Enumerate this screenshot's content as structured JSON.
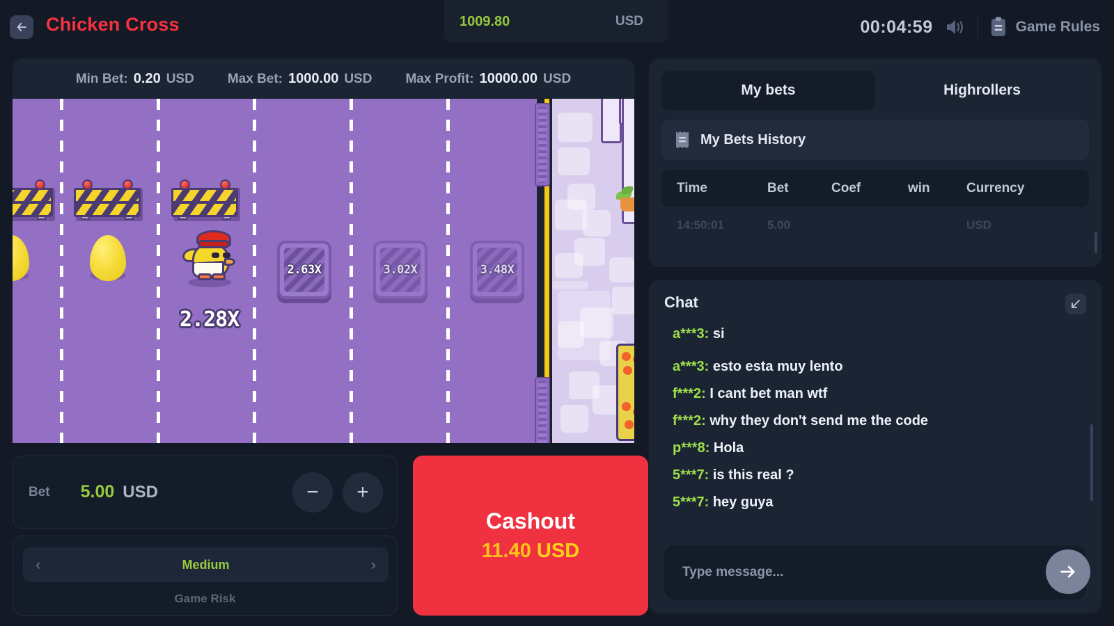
{
  "header": {
    "back_icon": "arrow-left-icon",
    "title": "Chicken Cross",
    "balance_value": "1009.80",
    "balance_currency": "USD",
    "timer": "00:04:59",
    "sound_icon": "speaker-on-icon",
    "rules_icon": "clipboard-icon",
    "rules_label": "Game Rules"
  },
  "limits": [
    {
      "label": "Min Bet:",
      "value": "0.20",
      "currency": "USD"
    },
    {
      "label": "Max Bet:",
      "value": "1000.00",
      "currency": "USD"
    },
    {
      "label": "Max Profit:",
      "value": "10000.00",
      "currency": "USD"
    }
  ],
  "game": {
    "current_multiplier": "2.28X",
    "upcoming_multipliers": [
      "2.63X",
      "3.02X",
      "3.48X"
    ],
    "road_color": "#9370c4",
    "sidewalk_color": "#d9cdee",
    "curb_color": "#f5c518"
  },
  "bet": {
    "label": "Bet",
    "value": "5.00",
    "currency": "USD",
    "decrease_label": "−",
    "increase_label": "+"
  },
  "risk": {
    "value": "Medium",
    "caption": "Game Risk",
    "prev_icon": "chevron-left-icon",
    "next_icon": "chevron-right-icon"
  },
  "cashout": {
    "title": "Cashout",
    "amount": "11.40",
    "currency": "USD",
    "color": "#f0313f"
  },
  "bets_panel": {
    "tabs": [
      {
        "label": "My bets",
        "active": true
      },
      {
        "label": "Highrollers",
        "active": false
      }
    ],
    "history_icon": "receipt-icon",
    "history_label": "My Bets History",
    "columns": [
      "Time",
      "Bet",
      "Coef",
      "win",
      "Currency"
    ],
    "rows": [
      {
        "time": "14:50:01",
        "bet": "5.00",
        "coef": "",
        "win": "",
        "currency": "USD"
      }
    ]
  },
  "chat": {
    "title": "Chat",
    "expand_icon": "collapse-arrow-icon",
    "messages": [
      {
        "user": "a***3:",
        "text": "si"
      },
      {
        "user": "a***3:",
        "text": "esto esta muy lento"
      },
      {
        "user": "f***2:",
        "text": "I cant bet man wtf"
      },
      {
        "user": "f***2:",
        "text": "why they don't send me the code"
      },
      {
        "user": "p***8:",
        "text": "Hola"
      },
      {
        "user": "5***7:",
        "text": "is this real ?"
      },
      {
        "user": "5***7:",
        "text": "hey guya"
      }
    ],
    "input_placeholder": "Type message...",
    "input_value": "",
    "send_icon": "arrow-right-icon",
    "user_color": "#9fe04a"
  }
}
